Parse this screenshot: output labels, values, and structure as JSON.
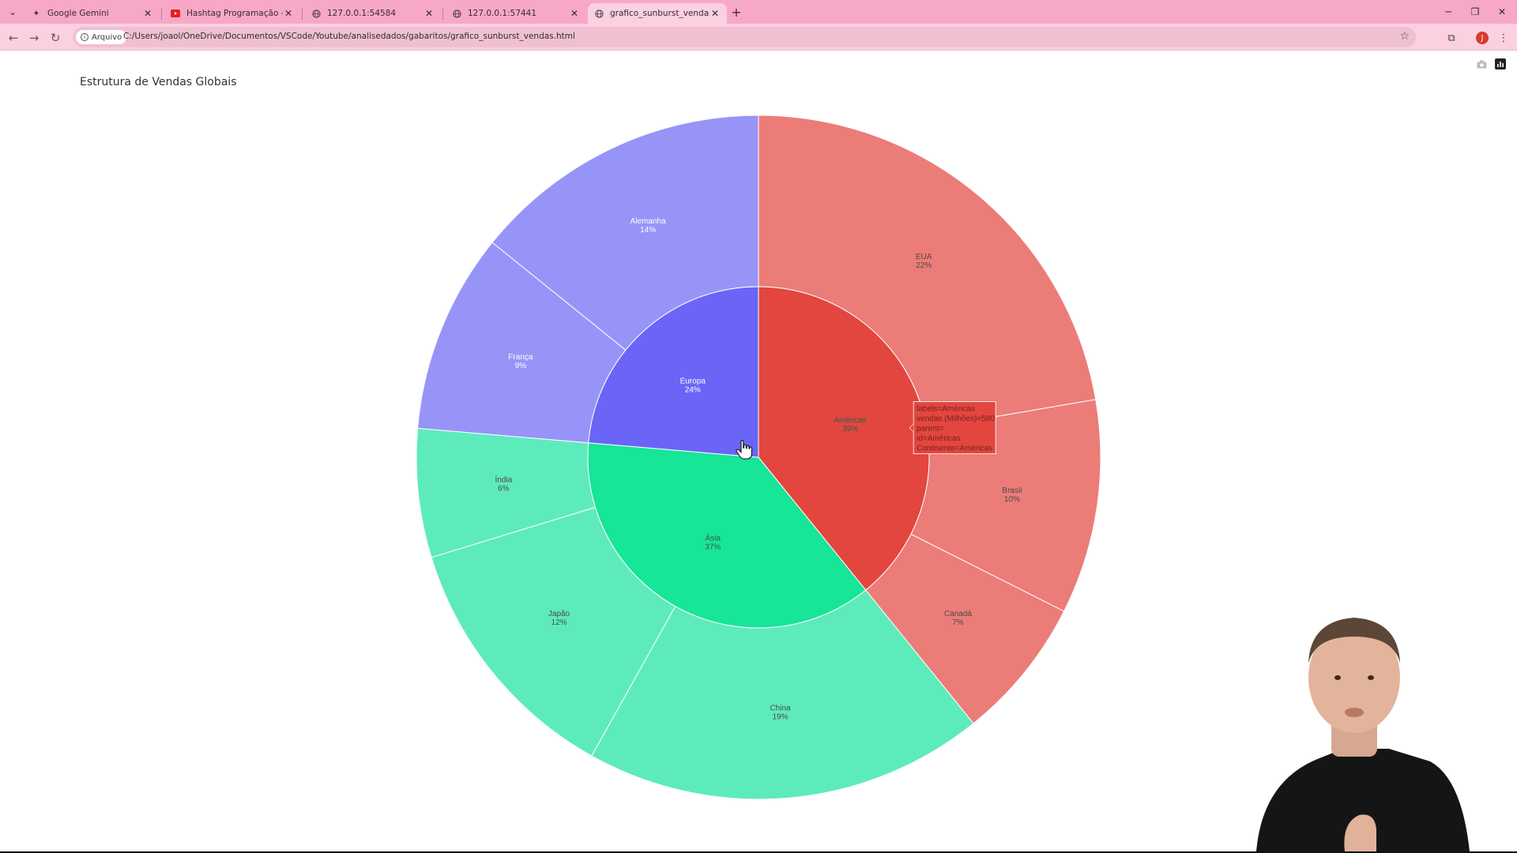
{
  "browser": {
    "tabs": [
      {
        "title": "Google Gemini",
        "icon": "gemini-icon",
        "active": false
      },
      {
        "title": "Hashtag Programação - YouTube",
        "icon": "youtube-icon",
        "active": false
      },
      {
        "title": "127.0.0.1:54584",
        "icon": "globe-icon",
        "active": false
      },
      {
        "title": "127.0.0.1:57441",
        "icon": "globe-icon",
        "active": false
      },
      {
        "title": "grafico_sunburst_vendas.html",
        "icon": "globe-icon",
        "active": true
      }
    ],
    "site_chip": "Arquivo",
    "url": "C:/Users/joaol/OneDrive/Documentos/VSCode/Youtube/analisedados/gabaritos/grafico_sunburst_vendas.html",
    "profile_initial": "J",
    "colors": {
      "tabbar": "#f7a8c7",
      "toolbar": "#fbd0e0"
    }
  },
  "chart": {
    "title": "Estrutura de Vendas Globais"
  },
  "chart_data": {
    "type": "sunburst",
    "title": "Estrutura de Vendas Globais",
    "value_field": "vendas (Milhões)",
    "continents": [
      {
        "name": "Américas",
        "percent": "39%",
        "value": 580,
        "color": "#e2463f",
        "child_color": "#ec7c78",
        "children": [
          {
            "name": "EUA",
            "percent": "22%",
            "value": 330
          },
          {
            "name": "Brasil",
            "percent": "10%",
            "value": 150
          },
          {
            "name": "Canadá",
            "percent": "7%",
            "value": 100
          }
        ]
      },
      {
        "name": "Ásia",
        "percent": "37%",
        "value": 550,
        "color": "#17e597",
        "child_color": "#5eebbc",
        "children": [
          {
            "name": "China",
            "percent": "19%",
            "value": 280
          },
          {
            "name": "Japão",
            "percent": "12%",
            "value": 180
          },
          {
            "name": "Índia",
            "percent": "6%",
            "value": 90
          }
        ]
      },
      {
        "name": "Europa",
        "percent": "24%",
        "value": 350,
        "color": "#6a65f6",
        "child_color": "#9794f8",
        "children": [
          {
            "name": "França",
            "percent": "9%",
            "value": 140
          },
          {
            "name": "Alemanha",
            "percent": "14%",
            "value": 210
          }
        ]
      }
    ],
    "hover": {
      "lines": [
        "labels=Américas",
        "vendas (Milhões)=580",
        "parent=",
        "id=Américas",
        "Continente=Américas"
      ]
    }
  }
}
